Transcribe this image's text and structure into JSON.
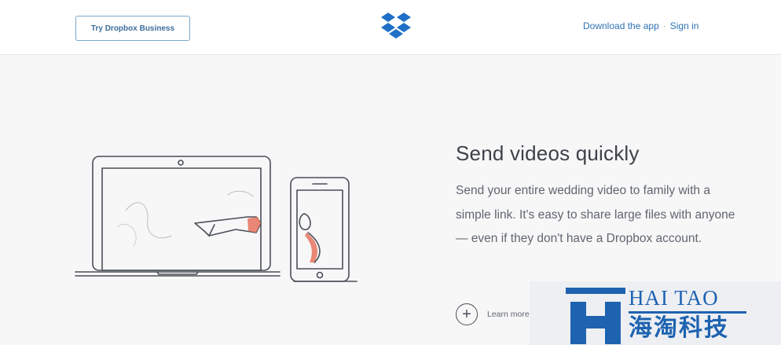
{
  "header": {
    "business_button": "Try Dropbox Business",
    "download_link": "Download the app",
    "separator": "·",
    "signin_link": "Sign in"
  },
  "feature": {
    "title": "Send videos quickly",
    "body": "Send your entire wedding video to family with a simple link. It's easy to share large files with anyone — even if they don't have a Dropbox account.",
    "learn_more": "Learn more",
    "learn_more_icon": "+"
  },
  "watermark": {
    "english": "HAI TAO",
    "chinese": "海淘科技"
  },
  "colors": {
    "accent_blue": "#2f73b5",
    "watermark_blue": "#1e63b0",
    "illustration_accent": "#e8735f"
  },
  "icons": [
    "dropbox-logo-icon",
    "plus-circle-icon",
    "laptop-illustration",
    "phone-illustration"
  ]
}
